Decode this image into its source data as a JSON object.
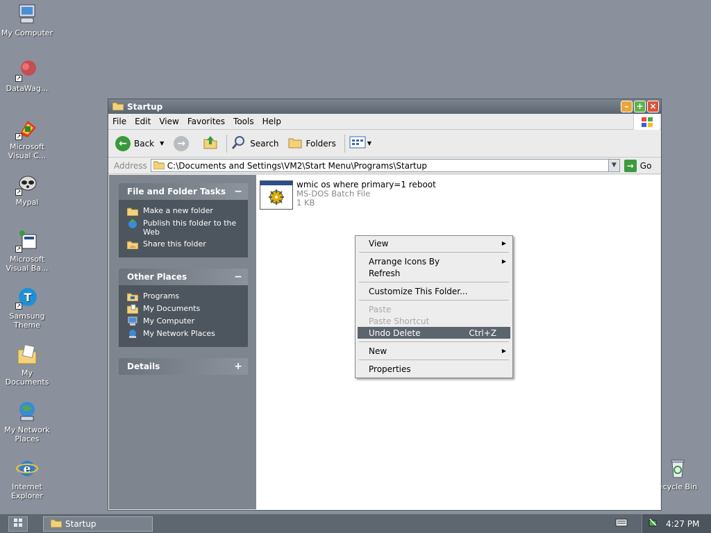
{
  "desktop": {
    "icons": [
      {
        "label": "My Computer"
      },
      {
        "label": "DataWag..."
      },
      {
        "label": "Microsoft Visual C..."
      },
      {
        "label": "Mypal"
      },
      {
        "label": "Microsoft Visual Ba..."
      },
      {
        "label": "Samsung Theme"
      },
      {
        "label": "My Documents"
      },
      {
        "label": "My Network Places"
      },
      {
        "label": "Internet Explorer"
      },
      {
        "label": "ecycle Bin"
      }
    ]
  },
  "window": {
    "title": "Startup",
    "menu": [
      "File",
      "Edit",
      "View",
      "Favorites",
      "Tools",
      "Help"
    ],
    "toolbar": {
      "back": "Back",
      "search": "Search",
      "folders": "Folders"
    },
    "address": {
      "label": "Address",
      "value": "C:\\Documents and Settings\\VM2\\Start Menu\\Programs\\Startup",
      "go": "Go"
    },
    "taskpane": {
      "file_tasks": {
        "title": "File and Folder Tasks",
        "toggle": "−",
        "items": [
          "Make a new folder",
          "Publish this folder to the Web",
          "Share this folder"
        ]
      },
      "other_places": {
        "title": "Other Places",
        "toggle": "−",
        "items": [
          "Programs",
          "My Documents",
          "My Computer",
          "My Network Places"
        ]
      },
      "details": {
        "title": "Details",
        "toggle": "+"
      }
    },
    "file": {
      "name": "wmic os where primary=1 reboot",
      "type": "MS-DOS Batch File",
      "size": "1 KB"
    }
  },
  "context_menu": {
    "view": "View",
    "arrange": "Arrange Icons By",
    "refresh": "Refresh",
    "customize": "Customize This Folder...",
    "paste": "Paste",
    "paste_shortcut": "Paste Shortcut",
    "undo": "Undo Delete",
    "undo_accel": "Ctrl+Z",
    "new": "New",
    "properties": "Properties"
  },
  "taskbar": {
    "task": "Startup",
    "clock": "4:27 PM"
  },
  "colors": {
    "desktop": "#8a919d",
    "taskpane": "#7e858e",
    "highlight": "#5c646d"
  }
}
